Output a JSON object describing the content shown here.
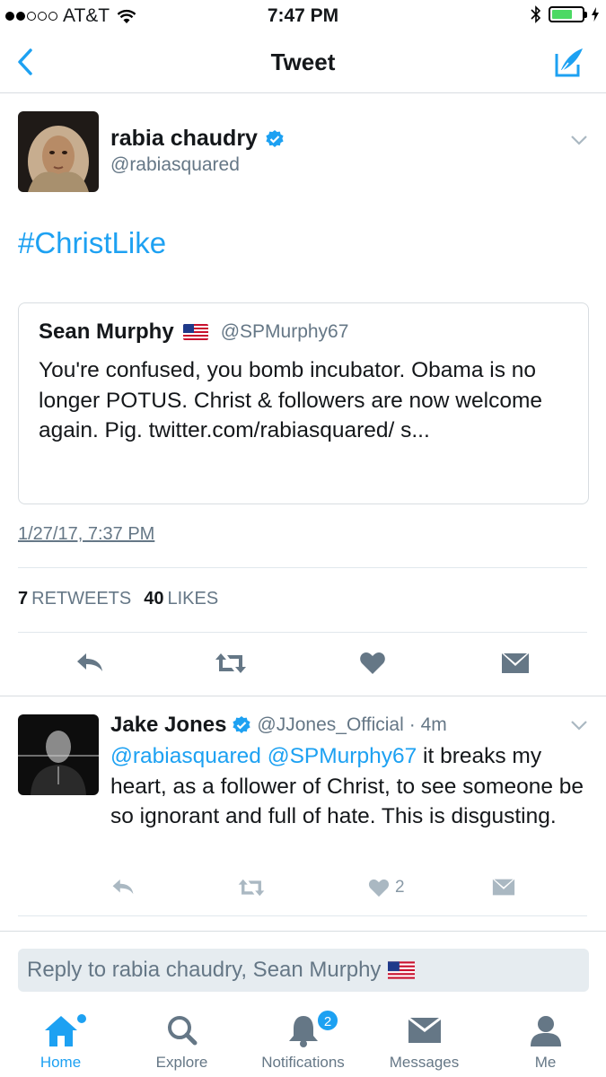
{
  "status_bar": {
    "carrier": "AT&T",
    "time": "7:47 PM",
    "battery_level": 0.7
  },
  "nav": {
    "title": "Tweet",
    "back_icon": "chevron-left-icon",
    "compose_icon": "compose-tweet-icon"
  },
  "tweet": {
    "author_name": "rabia chaudry",
    "author_handle": "@rabiasquared",
    "verified": true,
    "text": "#ChristLike",
    "quote": {
      "author_name": "Sean Murphy",
      "flag": "us-flag-icon",
      "author_handle": "@SPMurphy67",
      "text": "You're confused, you bomb incubator. Obama is no longer POTUS. Christ & followers are now welcome again. Pig. twitter.com/rabiasquared/ s..."
    },
    "timestamp": "1/27/17, 7:37 PM",
    "retweet_count": "7",
    "retweet_label": "RETWEETS",
    "like_count": "40",
    "like_label": "LIKES"
  },
  "reply": {
    "author_name": "Jake Jones",
    "verified": true,
    "author_handle": "@JJones_Official",
    "time_ago": "· 4m",
    "mention1": "@rabiasquared",
    "mention2": "@SPMurphy67",
    "text": "it breaks my heart, as a follower of Christ, to see someone be so ignorant and full of hate. This is disgusting.",
    "like_count": "2"
  },
  "reply_box": {
    "placeholder": "Reply to rabia chaudry, Sean Murphy"
  },
  "tabs": [
    {
      "label": "Home",
      "icon": "home-icon",
      "active": true
    },
    {
      "label": "Explore",
      "icon": "search-icon",
      "active": false
    },
    {
      "label": "Notifications",
      "icon": "bell-icon",
      "active": false,
      "badge": "2"
    },
    {
      "label": "Messages",
      "icon": "envelope-icon",
      "active": false
    },
    {
      "label": "Me",
      "icon": "person-icon",
      "active": false
    }
  ],
  "colors": {
    "accent": "#1da1f2",
    "secondary_text": "#657786",
    "icon_gray": "#8899a6"
  }
}
